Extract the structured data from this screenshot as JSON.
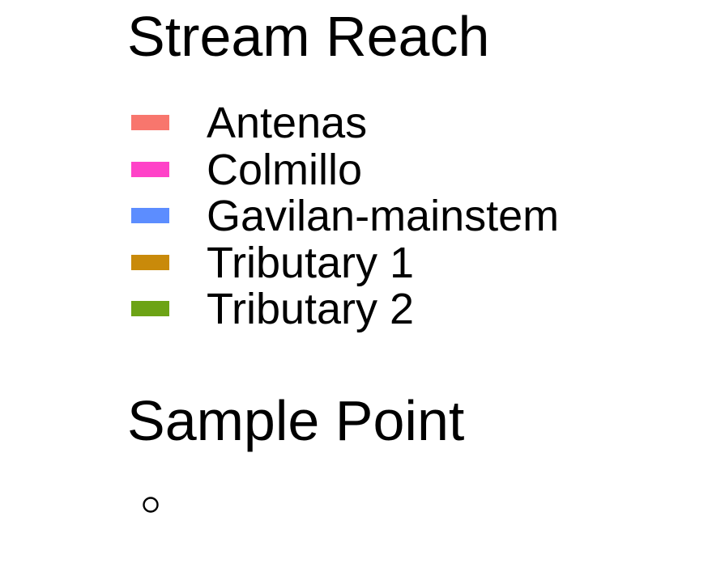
{
  "legend": {
    "stream_reach": {
      "title": "Stream Reach",
      "items": [
        {
          "label": "Antenas",
          "color": "#F8766D"
        },
        {
          "label": "Colmillo",
          "color": "#FF42C8"
        },
        {
          "label": "Gavilan-mainstem",
          "color": "#5C8DFF"
        },
        {
          "label": "Tributary 1",
          "color": "#C98A0A"
        },
        {
          "label": "Tributary 2",
          "color": "#6CA315"
        }
      ]
    },
    "sample_point": {
      "title": "Sample Point",
      "symbol": "open-circle",
      "color": "#000000"
    }
  }
}
